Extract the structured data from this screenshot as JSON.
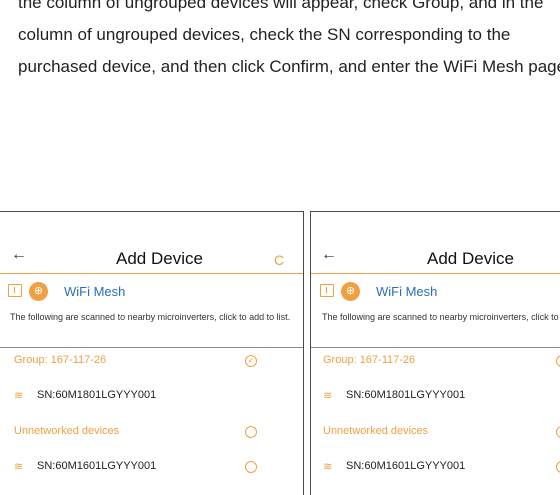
{
  "document": {
    "lines": [
      "the column of ungrouped devices will appear, check Group, and in the",
      "column of ungrouped devices, check the SN corresponding to the",
      "purchased device, and then click Confirm, and enter the WiFi Mesh page"
    ]
  },
  "screens": [
    {
      "nav": {
        "back_icon": "←",
        "title": "Add Device",
        "refresh_icon": "C"
      },
      "mesh": {
        "label": "WiFi Mesh",
        "circle_icon": "⊕"
      },
      "description": "The following are scanned to nearby microinverters, click to add to list.",
      "group_label": "Group: 167-117-26",
      "group_check": "✓",
      "device_1": "SN:60M1801LGYYY001",
      "unnetworked_label": "Unnetworked devices",
      "device_2": "SN:60M1601LGYYY001",
      "wifi_icon": "≋"
    },
    {
      "nav": {
        "back_icon": "←",
        "title": "Add Device"
      },
      "mesh": {
        "label": "WiFi Mesh",
        "circle_icon": "⊕"
      },
      "description": "The following are scanned to nearby microinverters, click to add to list.",
      "group_label": "Group: 167-117-26",
      "device_1": "SN:60M1801LGYYY001",
      "unnetworked_label": "Unnetworked devices",
      "device_2": "SN:60M1601LGYYY001",
      "wifi_icon": "≋"
    }
  ],
  "colors": {
    "accent": "#f0a040",
    "link": "#2c6fb6",
    "border": "#4a4a4a"
  }
}
